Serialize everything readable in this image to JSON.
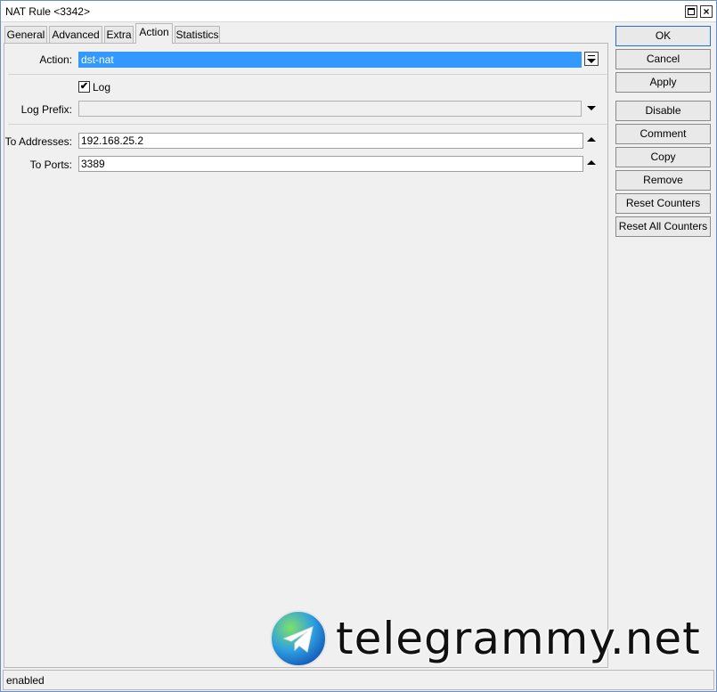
{
  "window": {
    "title": "NAT Rule <3342>"
  },
  "tabs": [
    {
      "label": "General",
      "active": false
    },
    {
      "label": "Advanced",
      "active": false
    },
    {
      "label": "Extra",
      "active": false
    },
    {
      "label": "Action",
      "active": true
    },
    {
      "label": "Statistics",
      "active": false
    }
  ],
  "action": {
    "label": "Action:",
    "value": "dst-nat"
  },
  "log": {
    "label": "Log",
    "checked": true,
    "check_glyph": "✔"
  },
  "log_prefix": {
    "label": "Log Prefix:",
    "value": ""
  },
  "to_addresses": {
    "label": "To Addresses:",
    "value": "192.168.25.2"
  },
  "to_ports": {
    "label": "To Ports:",
    "value": "3389"
  },
  "buttons": {
    "ok": "OK",
    "cancel": "Cancel",
    "apply": "Apply",
    "disable": "Disable",
    "comment": "Comment",
    "copy": "Copy",
    "remove": "Remove",
    "reset_counters": "Reset Counters",
    "reset_all_counters": "Reset All Counters"
  },
  "status": {
    "text": "enabled"
  },
  "watermark": {
    "text": "telegrammy.net",
    "icon": "telegram-globe-icon"
  },
  "colors": {
    "selection": "#3399ff",
    "window_border": "#6b8ec9",
    "default_button_border": "#1f6fd6"
  }
}
